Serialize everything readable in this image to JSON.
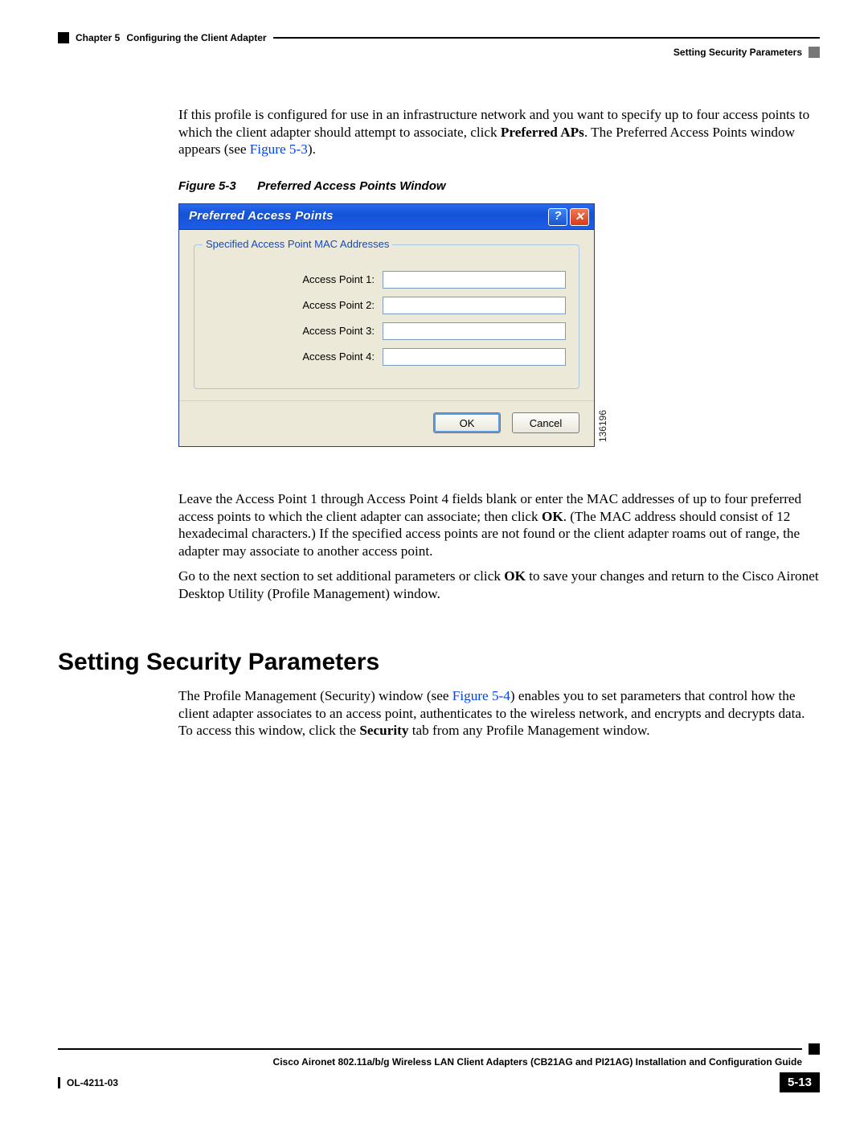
{
  "header": {
    "chapter_label": "Chapter 5",
    "chapter_title": "Configuring the Client Adapter",
    "section_title": "Setting Security Parameters"
  },
  "para1": {
    "pre": "If this profile is configured for use in an infrastructure network and you want to specify up to four access points to which the client adapter should attempt to associate, click ",
    "bold": "Preferred APs",
    "post1": ". The Preferred Access Points window appears (see ",
    "figref": "Figure 5-3",
    "post2": ")."
  },
  "figure": {
    "caption_label": "Figure 5-3",
    "caption_title": "Preferred Access Points Window",
    "image_id": "136196",
    "dialog": {
      "title": "Preferred Access Points",
      "help_char": "?",
      "close_char": "✕",
      "groupbox_legend": "Specified Access Point MAC Addresses",
      "fields": [
        {
          "label": "Access Point 1:",
          "value": ""
        },
        {
          "label": "Access Point 2:",
          "value": ""
        },
        {
          "label": "Access Point 3:",
          "value": ""
        },
        {
          "label": "Access Point 4:",
          "value": ""
        }
      ],
      "ok_label": "OK",
      "cancel_label": "Cancel"
    }
  },
  "para2": {
    "pre": "Leave the Access Point 1 through Access Point 4 fields blank or enter the MAC addresses of up to four preferred access points to which the client adapter can associate; then click ",
    "bold": "OK",
    "post": ". (The MAC address should consist of 12 hexadecimal characters.) If the specified access points are not found or the client adapter roams out of range, the adapter may associate to another access point."
  },
  "para3": {
    "pre": "Go to the next section to set additional parameters or click ",
    "bold": "OK",
    "post": " to save your changes and return to the Cisco Aironet Desktop Utility (Profile Management) window."
  },
  "h2": "Setting Security Parameters",
  "para4": {
    "pre": "The Profile Management (Security) window (see ",
    "figref": "Figure 5-4",
    "mid": ") enables you to set parameters that control how the client adapter associates to an access point, authenticates to the wireless network, and encrypts and decrypts data. To access this window, click the ",
    "bold": "Security",
    "post": " tab from any Profile Management window."
  },
  "footer": {
    "doc_title": "Cisco Aironet 802.11a/b/g Wireless LAN Client Adapters (CB21AG and PI21AG) Installation and Configuration Guide",
    "doc_code": "OL-4211-03",
    "page_number": "5-13"
  }
}
